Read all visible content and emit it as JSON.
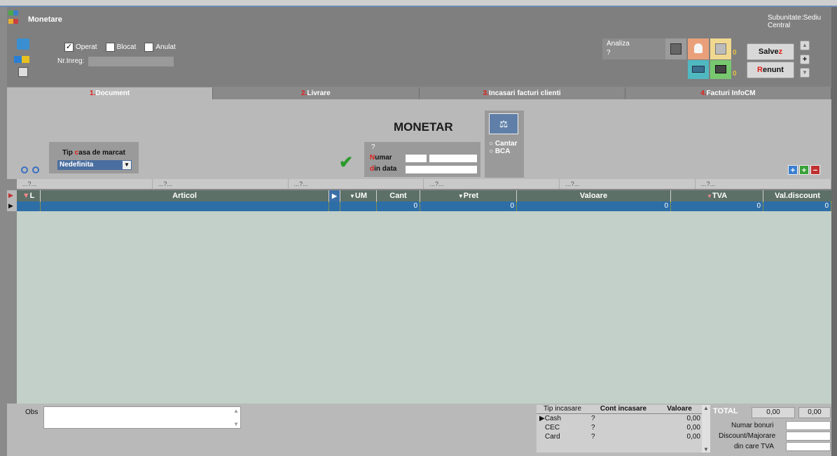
{
  "header": {
    "title": "Monetare",
    "subunit": "Subunitate:Sediu Central",
    "checkboxes": [
      {
        "label": "Operat",
        "checked": true
      },
      {
        "label": "Blocat",
        "checked": false
      },
      {
        "label": "Anulat",
        "checked": false
      }
    ],
    "nr_label": "Nr.Inreg:",
    "nr_value": "",
    "analiza_label": "Analiza",
    "analiza_value": "?",
    "badge_a": "0",
    "badge_b": "0",
    "save": {
      "prefix": "Salve",
      "hot": "z"
    },
    "cancel": {
      "hot": "R",
      "rest": "enunt"
    },
    "plus": "+"
  },
  "tabs": [
    {
      "num": "1.",
      "label": "Document",
      "active": true
    },
    {
      "num": "2.",
      "label": "Livrare",
      "active": false
    },
    {
      "num": "3.",
      "label": "Incasari facturi clienti",
      "active": false
    },
    {
      "num": "4.",
      "label": "Facturi InfoCM",
      "active": false
    }
  ],
  "document": {
    "heading": "MONETAR",
    "cash_type_label_a": "Tip ",
    "cash_type_label_hot": "c",
    "cash_type_label_b": "asa de marcat",
    "cash_type_value": "Nedefinita",
    "doc_q": "?",
    "numar_hot": "N",
    "numar_rest": "umar",
    "data_hot": "d",
    "data_rest": "in data",
    "radio": [
      "Cantar",
      "BCA"
    ]
  },
  "filters": [
    "...?...",
    "...?...",
    "...?...",
    "...?...",
    "...?...",
    "...?..."
  ],
  "grid": {
    "columns": [
      "L",
      "Articol",
      "UM",
      "Cant",
      "Pret",
      "Valoare",
      "TVA",
      "Val.discount"
    ],
    "row": [
      "",
      "",
      "",
      "0",
      "0",
      "0",
      "0",
      "0"
    ]
  },
  "bottom": {
    "obs_label": "Obs",
    "payment_headers": [
      "Tip incasare",
      "Cont incasare",
      "Valoare"
    ],
    "payments": [
      {
        "tip": "Cash",
        "cont": "?",
        "valoare": "0,00"
      },
      {
        "tip": "CEC",
        "cont": "?",
        "valoare": "0,00"
      },
      {
        "tip": "Card",
        "cont": "?",
        "valoare": "0,00"
      }
    ],
    "total_label": "TOTAL",
    "total_a": "0,00",
    "total_b": "0,00",
    "numar_bonuri": "Numar bonuri",
    "discount": "Discount/Majorare",
    "din_care_tva": "din care TVA"
  }
}
